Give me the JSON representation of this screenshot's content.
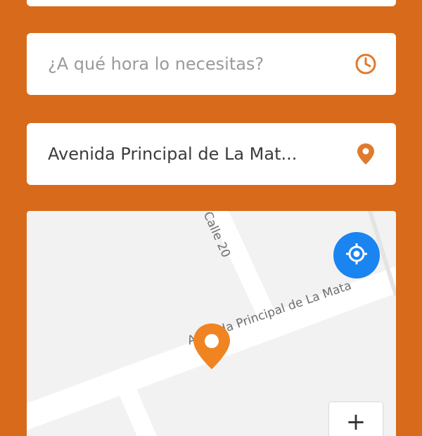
{
  "form": {
    "time_field": {
      "placeholder": "¿A qué hora lo necesitas?",
      "icon": "clock-icon"
    },
    "location_field": {
      "value": "Avenida Principal de La Mat...",
      "icon": "map-pin-icon"
    }
  },
  "map": {
    "streets": {
      "main": "Avenida Principal de La Mata",
      "calle": "Calle 20"
    },
    "locate_button_icon": "crosshair-icon",
    "zoom_in_label": "+"
  },
  "colors": {
    "background": "#D86A1B",
    "accent": "#E07A2E",
    "pin": "#F08422",
    "locate_button": "#1A84F0"
  }
}
